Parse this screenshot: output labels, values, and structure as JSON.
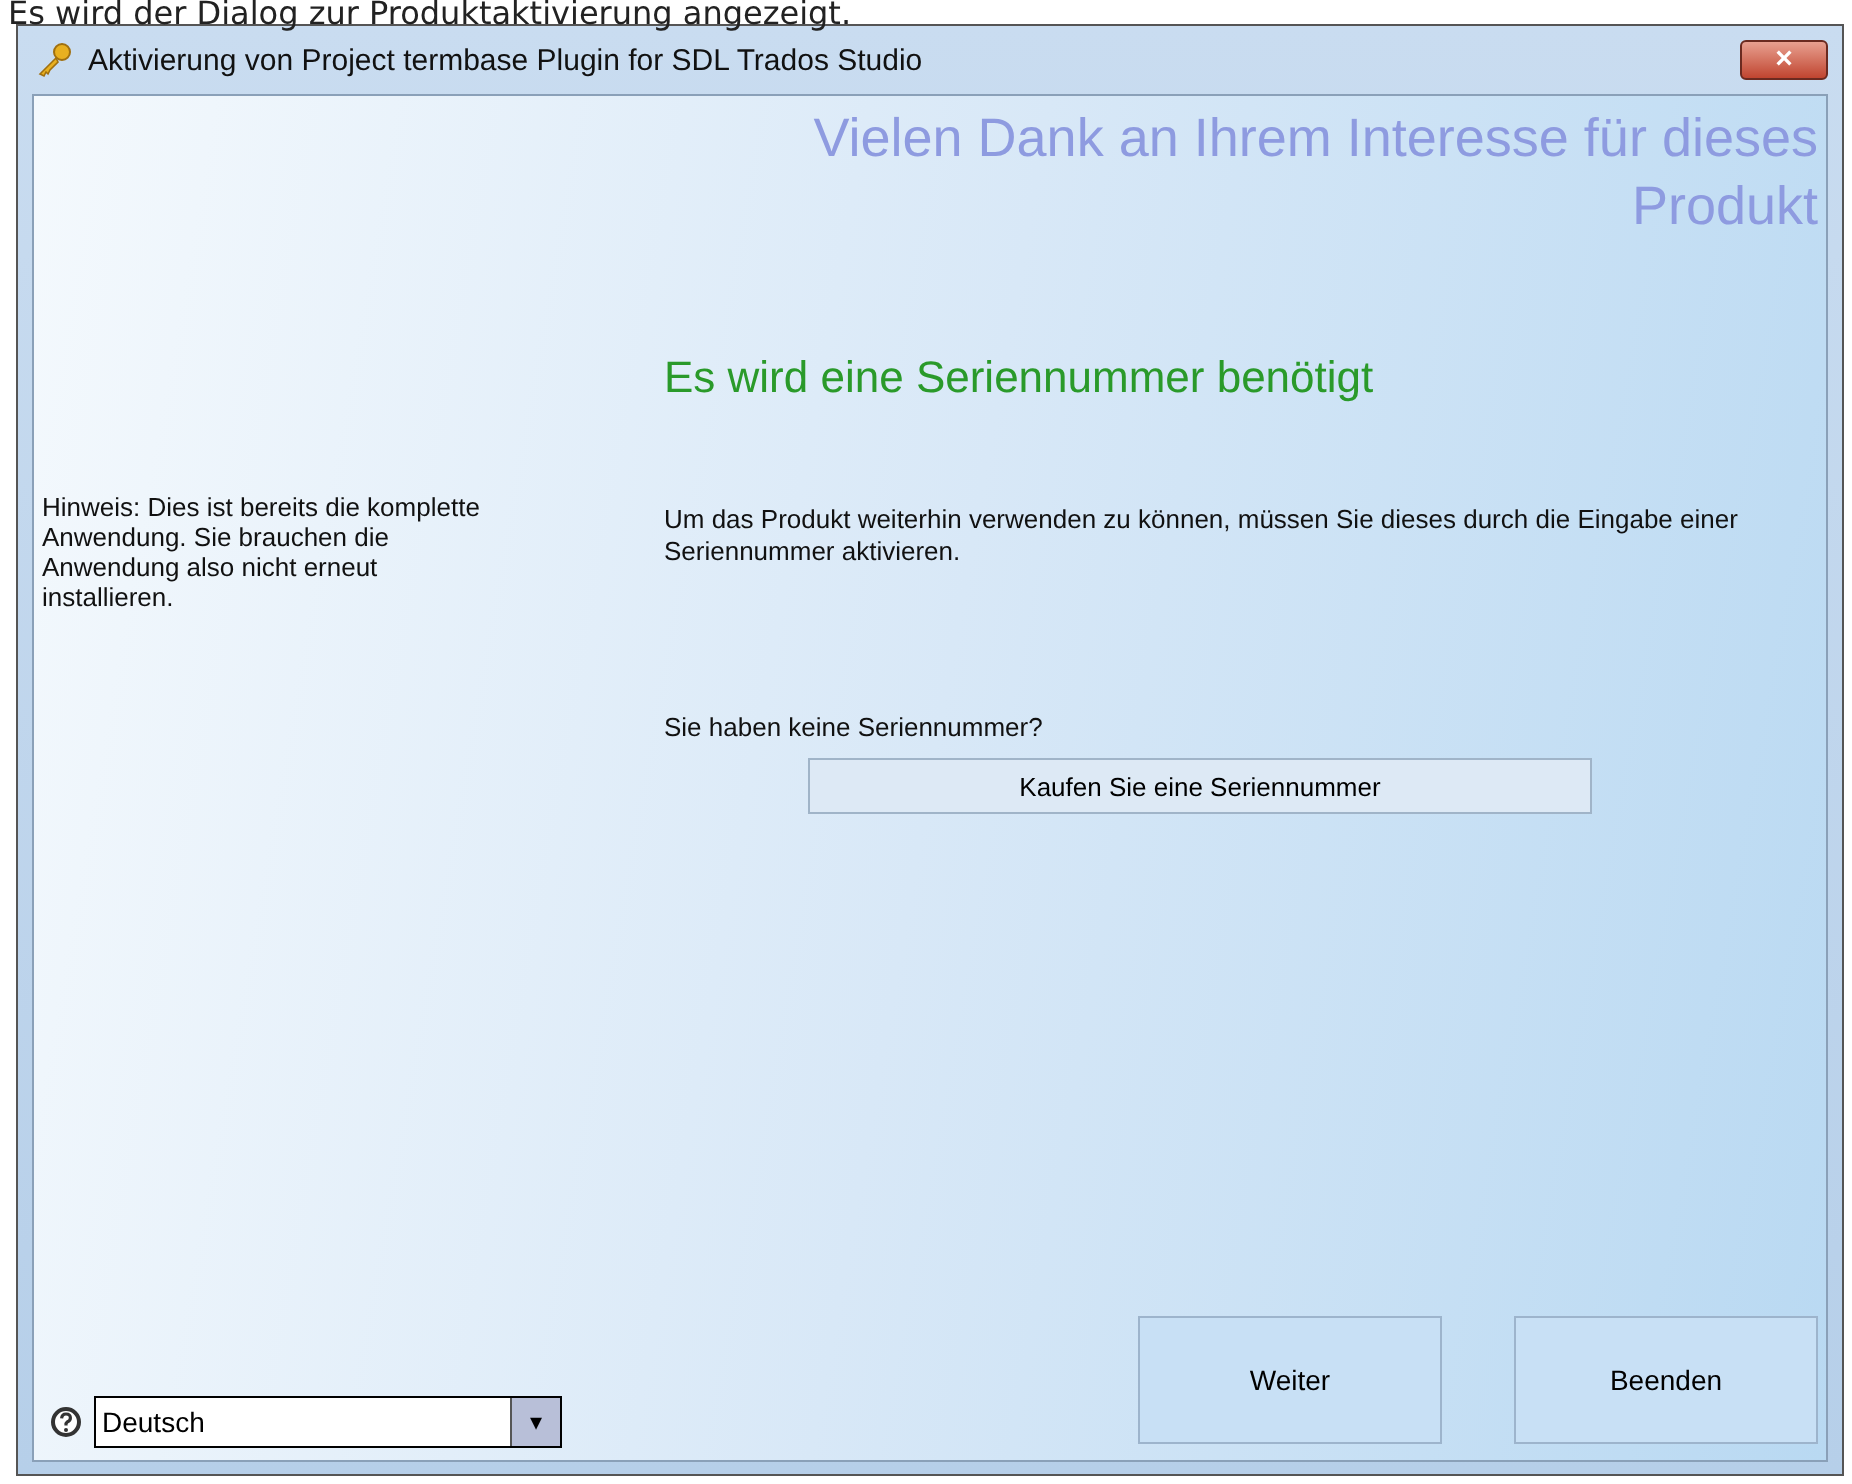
{
  "caption": "Es wird der Dialog zur Produktaktivierung angezeigt.",
  "window": {
    "title": "Aktivierung von Project termbase Plugin for SDL Trados Studio",
    "close": "×"
  },
  "sidebar": {
    "note": "Hinweis: Dies ist bereits die komplette Anwendung. Sie brauchen die Anwendung also nicht erneut installieren.",
    "language": {
      "value": "Deutsch",
      "arrow": "▾"
    }
  },
  "main": {
    "heading": "Vielen Dank an Ihrem Interesse für dieses Produkt",
    "subheading": "Es wird eine Seriennummer benötigt",
    "text": "Um das Produkt weiterhin verwenden zu können, müssen Sie dieses durch die Eingabe einer Seriennummer aktivieren.",
    "question": "Sie haben keine Seriennummer?",
    "buy_button": "Kaufen Sie eine Seriennummer"
  },
  "buttons": [
    "Weiter",
    "Beenden"
  ]
}
